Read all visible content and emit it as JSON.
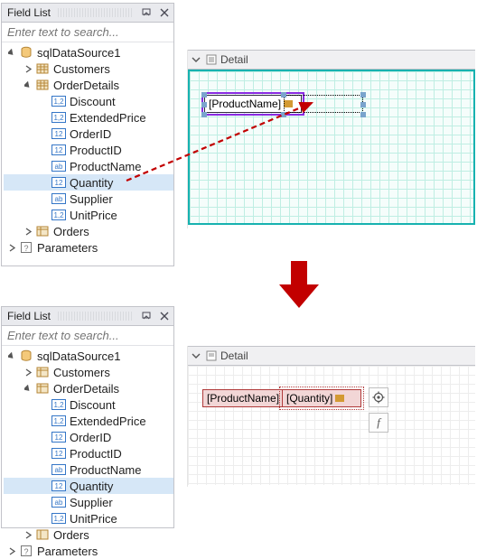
{
  "panel": {
    "title": "Field List",
    "search_placeholder": "Enter text to search...",
    "datasource": "sqlDataSource1",
    "tables": {
      "customers": "Customers",
      "orderdetails": "OrderDetails",
      "orders": "Orders"
    },
    "fields": {
      "discount": "Discount",
      "extendedprice": "ExtendedPrice",
      "orderid": "OrderID",
      "productid": "ProductID",
      "productname": "ProductName",
      "quantity": "Quantity",
      "supplier": "Supplier",
      "unitprice": "UnitPrice"
    },
    "parameters": "Parameters"
  },
  "field_type": {
    "discount": "1,2",
    "extendedprice": "1,2",
    "orderid": "12",
    "productid": "12",
    "productname": "ab",
    "quantity": "12",
    "supplier": "ab",
    "unitprice": "1,2"
  },
  "designer": {
    "band": "Detail",
    "top": {
      "field1": "[ProductName]"
    },
    "bottom": {
      "field1": "[ProductName]",
      "field2": "[Quantity]"
    }
  }
}
